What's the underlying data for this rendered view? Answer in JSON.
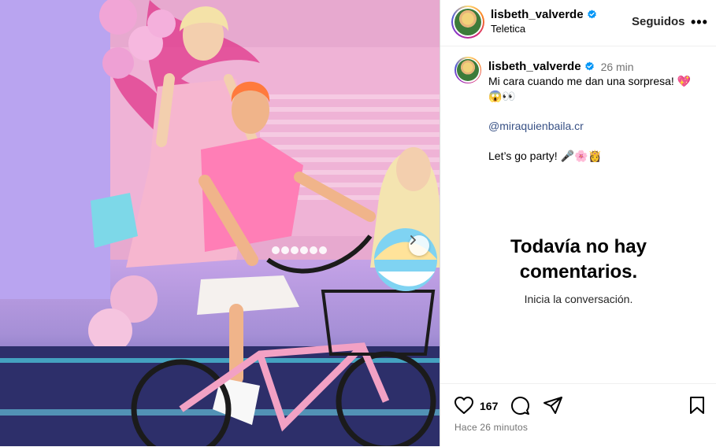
{
  "post": {
    "author": "lisbeth_valverde",
    "location": "Teletica",
    "follow_label": "Seguidos",
    "more_icon": "more-horizontal-icon",
    "verified_color": "#0095f6"
  },
  "caption": {
    "author": "lisbeth_valverde",
    "time": "26 min",
    "line1": "Mi cara cuando me dan una sorpresa! 💖",
    "line2": "😱👀",
    "mention": "@miraquienbaila.cr",
    "line3": "Let’s go party! 🎤🌸👸"
  },
  "comments": {
    "empty_title_1": "Todavía no hay",
    "empty_title_2": "comentarios.",
    "empty_subtitle": "Inicia la conversación."
  },
  "actions": {
    "like_count": "167",
    "time_ago": "Hace 26 minutos"
  },
  "colors": {
    "mention": "#385185",
    "muted": "#737373",
    "border": "#dbdbdb"
  }
}
